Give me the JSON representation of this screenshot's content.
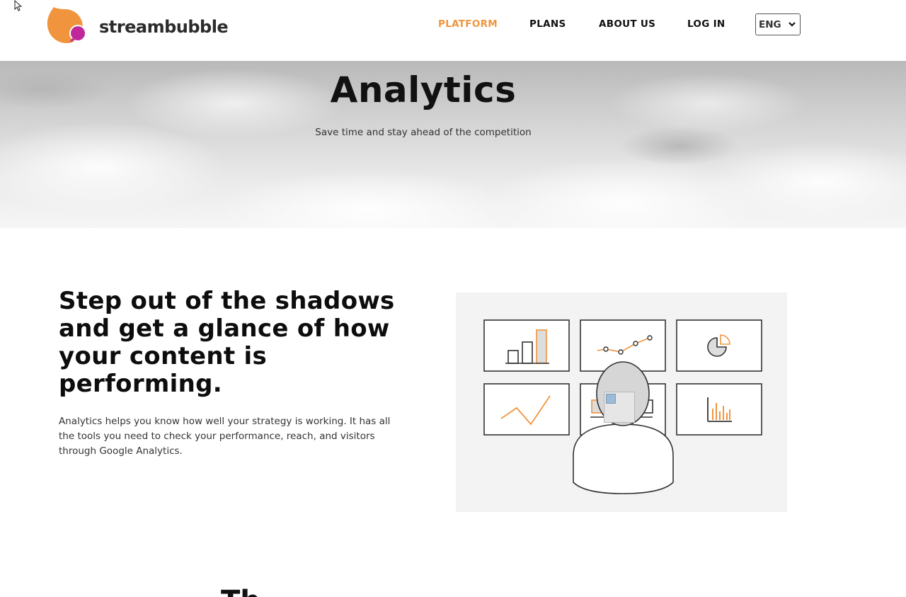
{
  "brand": {
    "name": "streambubble",
    "colors": {
      "orange": "#f0953e",
      "magenta": "#c0289a"
    }
  },
  "nav": {
    "items": [
      {
        "label": "PLATFORM",
        "active": true
      },
      {
        "label": "PLANS",
        "active": false
      },
      {
        "label": "ABOUT US",
        "active": false
      },
      {
        "label": "LOG IN",
        "active": false
      }
    ],
    "language": {
      "selected": "ENG",
      "icon": "chevron-down-icon"
    }
  },
  "hero": {
    "title": "Analytics",
    "subtitle": "Save time and stay ahead of the competition"
  },
  "feature": {
    "heading": "Step out of the shadows and get a glance of how your content is performing.",
    "body": "Analytics helps you know how well your strategy is working. It has all the tools you need to check your performance, reach, and visitors through Google Analytics.",
    "illustration_icons": [
      "bar-chart-icon",
      "line-chart-icon",
      "pie-chart-icon",
      "trend-line-icon",
      "laptop-icon",
      "column-chart-icon",
      "person-icon"
    ]
  },
  "next_section": {
    "heading_partial": "Th"
  }
}
